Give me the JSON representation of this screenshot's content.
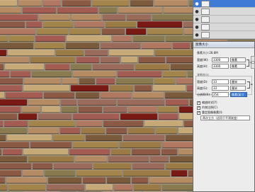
{
  "layers": [
    {
      "name": "",
      "fx": "",
      "selected": true
    },
    {
      "name": "",
      "fx": "",
      "selected": false
    },
    {
      "name": "",
      "fx": "",
      "selected": false
    },
    {
      "name": "",
      "fx": "",
      "selected": false
    },
    {
      "name": "",
      "fx": "",
      "selected": false
    }
  ],
  "dialog": {
    "title": "图像大小",
    "pixel_dimensions_label": "像素大小:28.8M",
    "pixel_width_label": "宽度(W):",
    "pixel_width_value": "3300",
    "pixel_height_label": "高度(H):",
    "pixel_height_value": "3300",
    "pixel_unit": "像素",
    "document_size_label": "文档大小:",
    "doc_width_label": "宽度(D):",
    "doc_width_value": "33",
    "doc_height_label": "高度(G):",
    "doc_height_value": "33",
    "doc_unit": "厘米",
    "resolution_label": "分辨率(R):",
    "resolution_value": "254",
    "resolution_unit": "像素/英寸",
    "scale_styles_label": "缩放样式(Y)",
    "constrain_label": "约束比例(C)",
    "resample_label": "重定图像像素(I):",
    "resample_method": "两次立方（适用于平滑渐变）"
  },
  "colors": {
    "selection": "#3d7ad6",
    "panel_bg": "#ececec"
  }
}
